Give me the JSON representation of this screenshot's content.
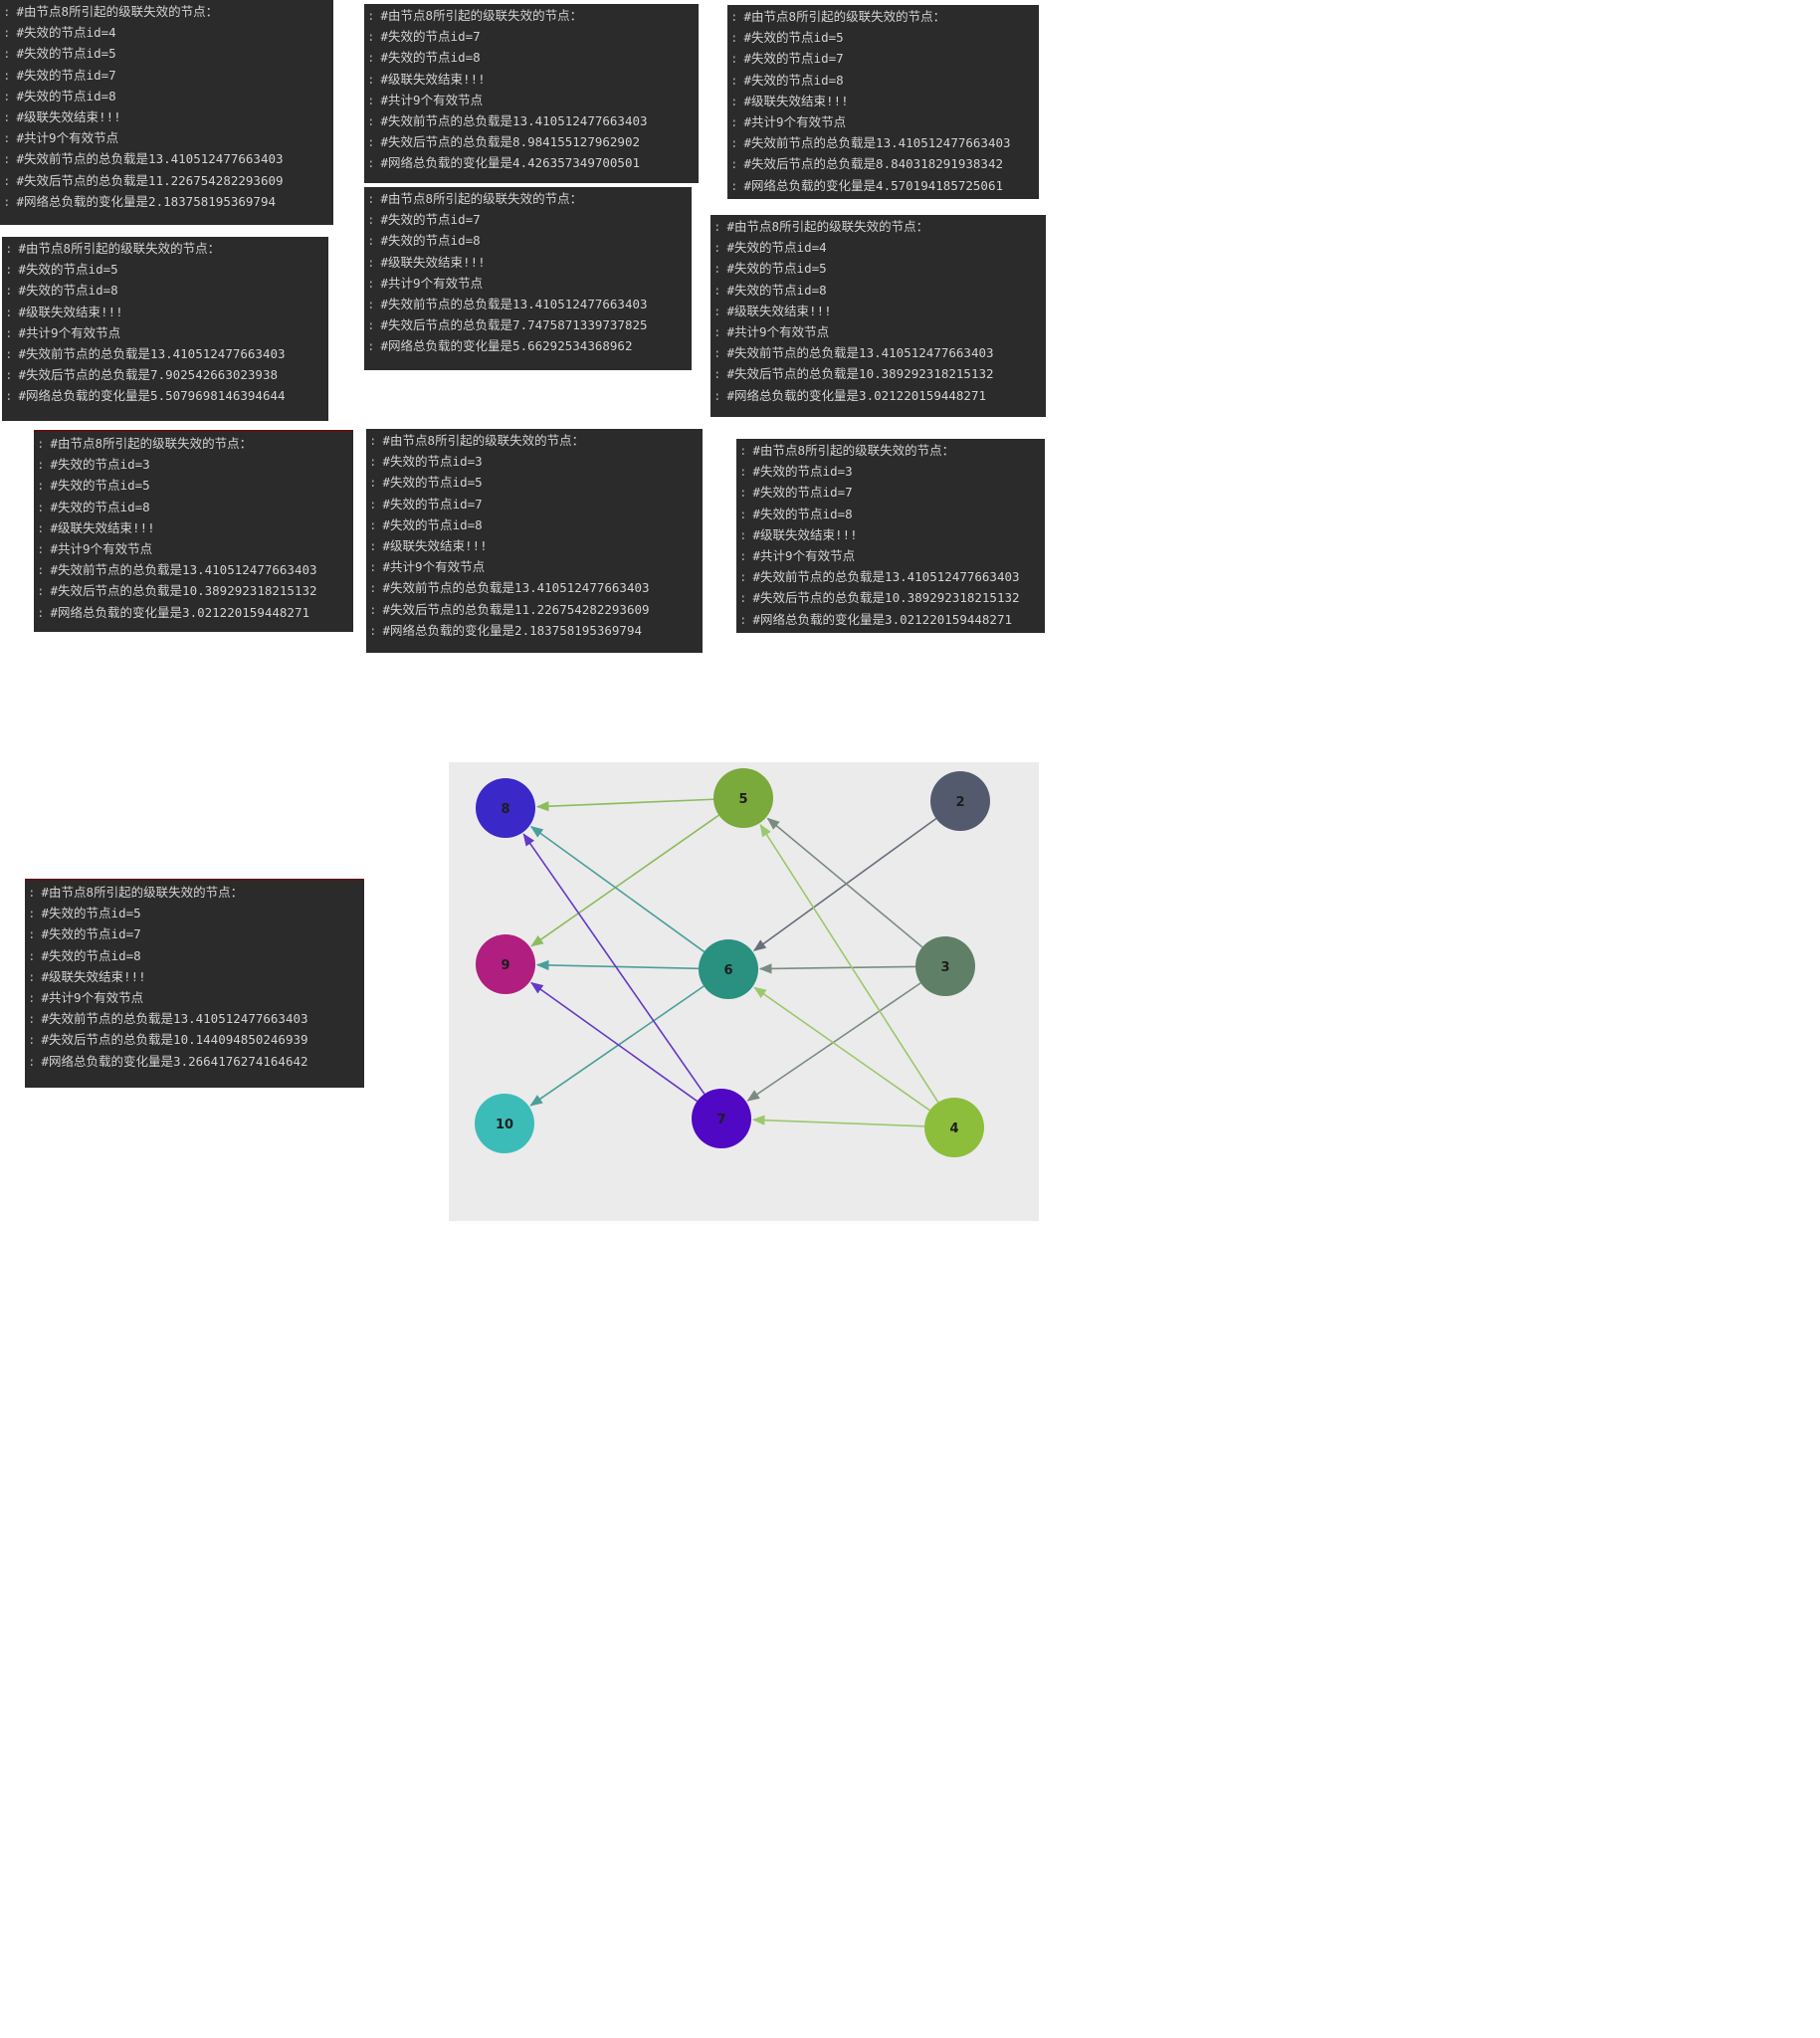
{
  "consoles": [
    {
      "lines": [
        "#由节点8所引起的级联失效的节点：",
        "#失效的节点id=4",
        "#失效的节点id=5",
        "#失效的节点id=7",
        "#失效的节点id=8",
        "#级联失效结束!!!",
        "#共计9个有效节点",
        "#失效前节点的总负载是13.410512477663403",
        "#失效后节点的总负载是11.226754282293609",
        "#网络总负载的变化量是2.183758195369794"
      ]
    },
    {
      "lines": [
        "#由节点8所引起的级联失效的节点：",
        "#失效的节点id=7",
        "#失效的节点id=8",
        "#级联失效结束!!!",
        "#共计9个有效节点",
        "#失效前节点的总负载是13.410512477663403",
        "#失效后节点的总负载是8.984155127962902",
        "#网络总负载的变化量是4.426357349700501"
      ]
    },
    {
      "lines": [
        "#由节点8所引起的级联失效的节点：",
        "#失效的节点id=5",
        "#失效的节点id=7",
        "#失效的节点id=8",
        "#级联失效结束!!!",
        "#共计9个有效节点",
        "#失效前节点的总负载是13.410512477663403",
        "#失效后节点的总负载是8.840318291938342",
        "#网络总负载的变化量是4.570194185725061"
      ]
    },
    {
      "lines": [
        "#由节点8所引起的级联失效的节点：",
        "#失效的节点id=7",
        "#失效的节点id=8",
        "#级联失效结束!!!",
        "#共计9个有效节点",
        "#失效前节点的总负载是13.410512477663403",
        "#失效后节点的总负载是7.7475871339737825",
        "#网络总负载的变化量是5.66292534368962"
      ]
    },
    {
      "lines": [
        "#由节点8所引起的级联失效的节点：",
        "#失效的节点id=5",
        "#失效的节点id=8",
        "#级联失效结束!!!",
        "#共计9个有效节点",
        "#失效前节点的总负载是13.410512477663403",
        "#失效后节点的总负载是7.902542663023938",
        "#网络总负载的变化量是5.5079698146394644"
      ]
    },
    {
      "lines": [
        "#由节点8所引起的级联失效的节点：",
        "#失效的节点id=4",
        "#失效的节点id=5",
        "#失效的节点id=8",
        "#级联失效结束!!!",
        "#共计9个有效节点",
        "#失效前节点的总负载是13.410512477663403",
        "#失效后节点的总负载是10.389292318215132",
        "#网络总负载的变化量是3.021220159448271"
      ]
    },
    {
      "lines": [
        "#由节点8所引起的级联失效的节点：",
        "#失效的节点id=3",
        "#失效的节点id=5",
        "#失效的节点id=8",
        "#级联失效结束!!!",
        "#共计9个有效节点",
        "#失效前节点的总负载是13.410512477663403",
        "#失效后节点的总负载是10.389292318215132",
        "#网络总负载的变化量是3.021220159448271"
      ]
    },
    {
      "lines": [
        "#由节点8所引起的级联失效的节点：",
        "#失效的节点id=3",
        "#失效的节点id=5",
        "#失效的节点id=7",
        "#失效的节点id=8",
        "#级联失效结束!!!",
        "#共计9个有效节点",
        "#失效前节点的总负载是13.410512477663403",
        "#失效后节点的总负载是11.226754282293609",
        "#网络总负载的变化量是2.183758195369794"
      ]
    },
    {
      "lines": [
        "#由节点8所引起的级联失效的节点：",
        "#失效的节点id=3",
        "#失效的节点id=7",
        "#失效的节点id=8",
        "#级联失效结束!!!",
        "#共计9个有效节点",
        "#失效前节点的总负载是13.410512477663403",
        "#失效后节点的总负载是10.389292318215132",
        "#网络总负载的变化量是3.021220159448271"
      ]
    },
    {
      "lines": [
        "#由节点8所引起的级联失效的节点：",
        "#失效的节点id=5",
        "#失效的节点id=7",
        "#失效的节点id=8",
        "#级联失效结束!!!",
        "#共计9个有效节点",
        "#失效前节点的总负载是13.410512477663403",
        "#失效后节点的总负载是10.144094850246939",
        "#网络总负载的变化量是3.2664176274164642"
      ]
    }
  ],
  "graph": {
    "nodes": [
      {
        "id": "8",
        "label": "8",
        "color": "#3a28c8"
      },
      {
        "id": "5",
        "label": "5",
        "color": "#7aa93c"
      },
      {
        "id": "2",
        "label": "2",
        "color": "#545a6e"
      },
      {
        "id": "9",
        "label": "9",
        "color": "#b01e80"
      },
      {
        "id": "6",
        "label": "6",
        "color": "#2a9080"
      },
      {
        "id": "3",
        "label": "3",
        "color": "#5f8066"
      },
      {
        "id": "10",
        "label": "10",
        "color": "#3cbcb8"
      },
      {
        "id": "7",
        "label": "7",
        "color": "#5008c4"
      },
      {
        "id": "4",
        "label": "4",
        "color": "#8cbe3c"
      }
    ],
    "edges": [
      {
        "from": "5",
        "to": "8",
        "color": "#8cbc5c"
      },
      {
        "from": "5",
        "to": "9",
        "color": "#8cbc5c"
      },
      {
        "from": "6",
        "to": "8",
        "color": "#48a098"
      },
      {
        "from": "6",
        "to": "9",
        "color": "#48a098"
      },
      {
        "from": "6",
        "to": "10",
        "color": "#48a098"
      },
      {
        "from": "7",
        "to": "8",
        "color": "#6438c8"
      },
      {
        "from": "7",
        "to": "9",
        "color": "#6438c8"
      },
      {
        "from": "2",
        "to": "6",
        "color": "#686e7c"
      },
      {
        "from": "3",
        "to": "5",
        "color": "#7a8c80"
      },
      {
        "from": "3",
        "to": "6",
        "color": "#7a8c80"
      },
      {
        "from": "3",
        "to": "7",
        "color": "#7a8c80"
      },
      {
        "from": "4",
        "to": "5",
        "color": "#9cc86c"
      },
      {
        "from": "4",
        "to": "6",
        "color": "#9cc86c"
      },
      {
        "from": "4",
        "to": "7",
        "color": "#9cc86c"
      }
    ]
  }
}
